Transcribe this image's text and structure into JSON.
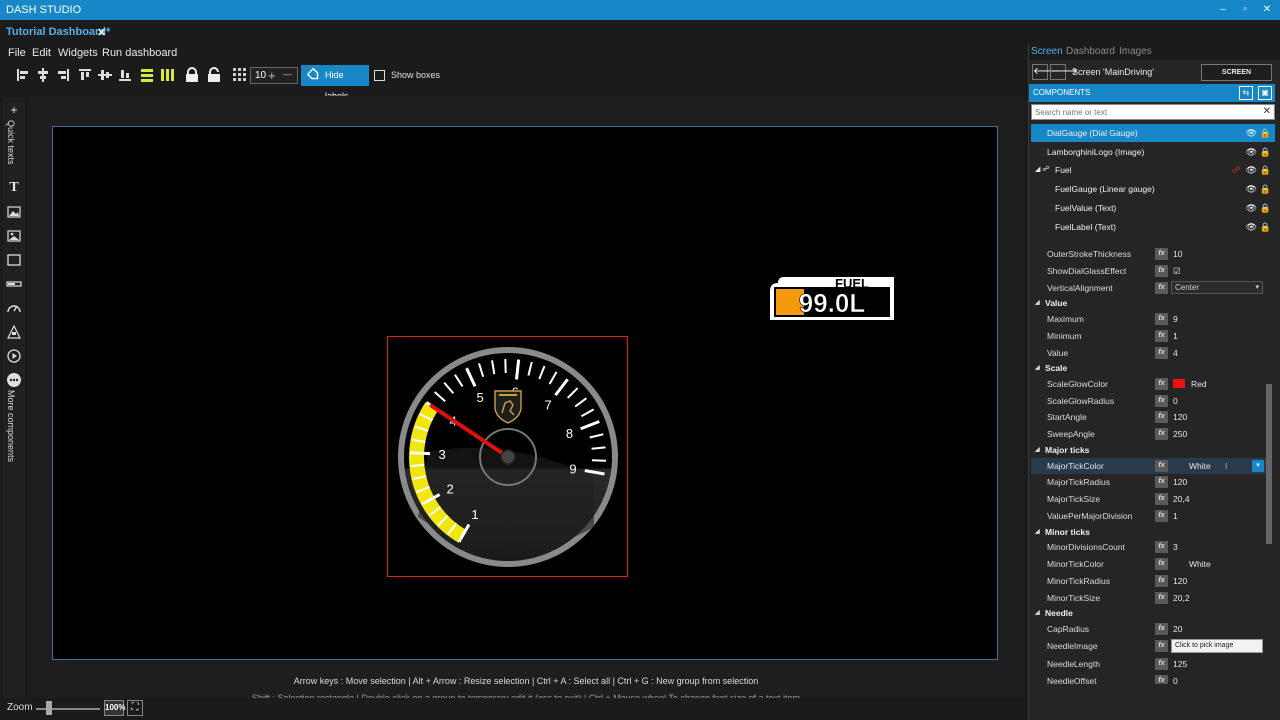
{
  "titlebar": {
    "app_title": "DASH STUDIO",
    "minimize": "–",
    "maximize": "▫",
    "close": "✕"
  },
  "document": {
    "tab_title": "Tutorial Dashboard*",
    "close_glyph": "✕"
  },
  "menu": [
    "File",
    "Edit",
    "Widgets",
    "Run dashboard"
  ],
  "toolbar": {
    "grid_size": "10",
    "grid_plus": "+",
    "grid_minus": "—",
    "hide_labels": "Hide labels",
    "show_boxes": "Show boxes"
  },
  "left_rail": {
    "quick_texts": "Quick texts",
    "more_components": "More components",
    "text_glyph": "T"
  },
  "canvas": {
    "fuel_logo_top": "FUEL",
    "fuel_logo_value": "99.0L",
    "gauge": {
      "minimum": 1,
      "maximum": 9,
      "value": 4,
      "start_angle": 120,
      "sweep_angle": 250,
      "scale_glow_color": "#ff0000",
      "major_tick_color": "#ffffff",
      "needle_color": "#e01010",
      "band_color": "#f2e60f",
      "tick_labels": [
        "1",
        "2",
        "3",
        "4",
        "5",
        "6",
        "7",
        "8",
        "9"
      ]
    },
    "hint_line_1": "Arrow keys : Move selection | Alt + Arrow : Resize selection | Ctrl + A : Select all | Ctrl + G : New group from selection",
    "hint_line_2": "Shift : Selection rectangle | Double click on a group to temporary edit it (esc to exit) | Ctrl + Mouse wheel To change font size of a text item"
  },
  "zoom": {
    "label": "Zoom",
    "value": "100%",
    "fit_glyph": "⛶",
    "slider_fraction": 0.2
  },
  "right_panel": {
    "tabs": [
      "Screen",
      "Dashboard",
      "Images"
    ],
    "active_tab": "Screen",
    "screen_name": "Screen 'MainDriving'",
    "screen_properties": "SCREEN PROPERTIES",
    "nav_back": "🡐",
    "nav_forward": "🡒",
    "components_title": "COMPONENTS",
    "search_placeholder": "Search name or text",
    "components": [
      {
        "label": "DialGauge  (Dial Gauge)",
        "selected": true,
        "indent": 0
      },
      {
        "label": "LamborghiniLogo  (Image)",
        "selected": false,
        "indent": 0
      },
      {
        "label": "Fuel",
        "selected": false,
        "indent": 0,
        "group": true
      },
      {
        "label": "FuelGauge  (Linear gauge)",
        "selected": false,
        "indent": 1
      },
      {
        "label": "FuelValue  (Text)",
        "selected": false,
        "indent": 1
      },
      {
        "label": "FuelLabel  (Text)",
        "selected": false,
        "indent": 1
      }
    ],
    "properties": [
      {
        "kind": "row",
        "name": "OuterStrokeThickness",
        "value": "10"
      },
      {
        "kind": "row",
        "name": "ShowDialGlassEffect",
        "value": "☑"
      },
      {
        "kind": "combo",
        "name": "VerticalAlignment",
        "value": "Center"
      },
      {
        "kind": "section",
        "name": "Value"
      },
      {
        "kind": "row",
        "name": "Maximum",
        "value": "9"
      },
      {
        "kind": "row",
        "name": "Minimum",
        "value": "1"
      },
      {
        "kind": "row",
        "name": "Value",
        "value": "4"
      },
      {
        "kind": "section",
        "name": "Scale"
      },
      {
        "kind": "color",
        "name": "ScaleGlowColor",
        "value": "Red"
      },
      {
        "kind": "row",
        "name": "ScaleGlowRadius",
        "value": "0"
      },
      {
        "kind": "row",
        "name": "StartAngle",
        "value": "120"
      },
      {
        "kind": "row",
        "name": "SweepAngle",
        "value": "250"
      },
      {
        "kind": "section",
        "name": "Major ticks"
      },
      {
        "kind": "colorsel",
        "name": "MajorTickColor",
        "value": "White"
      },
      {
        "kind": "row",
        "name": "MajorTickRadius",
        "value": "120"
      },
      {
        "kind": "row",
        "name": "MajorTickSize",
        "value": "20,4"
      },
      {
        "kind": "row",
        "name": "ValuePerMajorDivision",
        "value": "1"
      },
      {
        "kind": "section",
        "name": "Minor ticks"
      },
      {
        "kind": "row",
        "name": "MinorDivisionsCount",
        "value": "3"
      },
      {
        "kind": "white",
        "name": "MinorTickColor",
        "value": "White"
      },
      {
        "kind": "row",
        "name": "MinorTickRadius",
        "value": "120"
      },
      {
        "kind": "row",
        "name": "MinorTickSize",
        "value": "20,2"
      },
      {
        "kind": "section",
        "name": "Needle"
      },
      {
        "kind": "row",
        "name": "CapRadius",
        "value": "20"
      },
      {
        "kind": "pick",
        "name": "NeedleImage",
        "value": "Click to pick image"
      },
      {
        "kind": "row",
        "name": "NeedleLength",
        "value": "125"
      },
      {
        "kind": "row",
        "name": "NeedleOffset",
        "value": "0"
      }
    ]
  }
}
